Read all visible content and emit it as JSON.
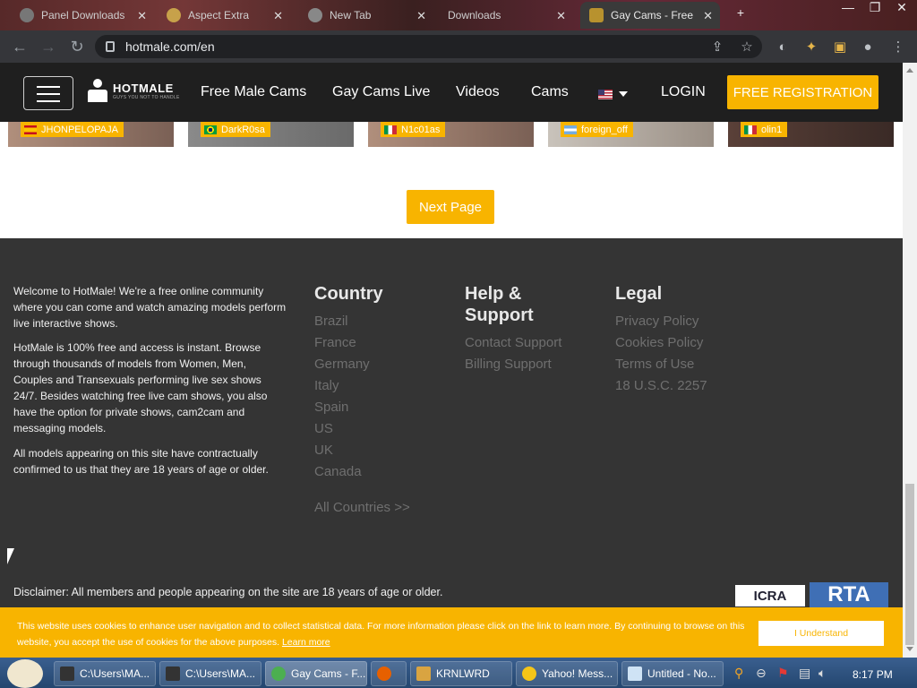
{
  "browser": {
    "tabs": [
      {
        "label": "Panel Downloads"
      },
      {
        "label": "Aspect Extra"
      },
      {
        "label": "New Tab"
      },
      {
        "label": "Downloads"
      },
      {
        "label": "Gay Cams - Free"
      }
    ],
    "url": "hotmale.com/en"
  },
  "header": {
    "logo_text": "HOTMALE",
    "logo_tagline": "GUYS YOU NOT TO HANDLE",
    "nav": [
      "Free Male Cams",
      "Gay Cams Live",
      "Videos",
      "Cams"
    ],
    "login": "LOGIN",
    "register": "FREE REGISTRATION"
  },
  "thumbs": [
    {
      "name": "JHONPELOPAJA",
      "flag": "spain"
    },
    {
      "name": "DarkR0sa",
      "flag": "brazil"
    },
    {
      "name": "N1c01as",
      "flag": "italy"
    },
    {
      "name": "foreign_off",
      "flag": "argentina"
    },
    {
      "name": "olin1",
      "flag": "italy"
    }
  ],
  "next_page": "Next Page",
  "footer": {
    "about": [
      "Welcome to HotMale! We're a free online community where you can come and watch amazing models perform live interactive shows.",
      "HotMale is 100% free and access is instant. Browse through thousands of models from Women, Men, Couples and Transexuals performing live sex shows 24/7. Besides watching free live cam shows, you also have the option for private shows, cam2cam and messaging models.",
      "All models appearing on this site have contractually confirmed to us that they are 18 years of age or older."
    ],
    "country_title": "Country",
    "countries": [
      "Brazil",
      "France",
      "Germany",
      "Italy",
      "Spain",
      "US",
      "UK",
      "Canada"
    ],
    "all_countries": "All Countries >>",
    "help_title_1": "Help &",
    "help_title_2": "Support",
    "help_links": [
      "Contact Support",
      "Billing Support"
    ],
    "legal_title": "Legal",
    "legal_links": [
      "Privacy Policy",
      "Cookies Policy",
      "Terms of Use",
      "18 U.S.C. 2257"
    ],
    "disclaimer": "Disclaimer: All members and people appearing on the site are 18 years of age or older.",
    "icra": "ICRA",
    "rta": "RTA"
  },
  "cookie": {
    "text": "This website uses cookies to enhance user navigation and to collect statistical data. For more information please click on the link to learn more. By continuing to browse on this website, you accept the use of cookies for the above purposes.",
    "learn_more": "Learn more",
    "button": "I Understand"
  },
  "taskbar": {
    "items": [
      "C:\\Users\\MA...",
      "C:\\Users\\MA...",
      "Gay Cams - F...",
      "",
      "KRNLWRD",
      "Yahoo! Mess...",
      "Untitled - No..."
    ],
    "clock": "8:17 PM"
  }
}
